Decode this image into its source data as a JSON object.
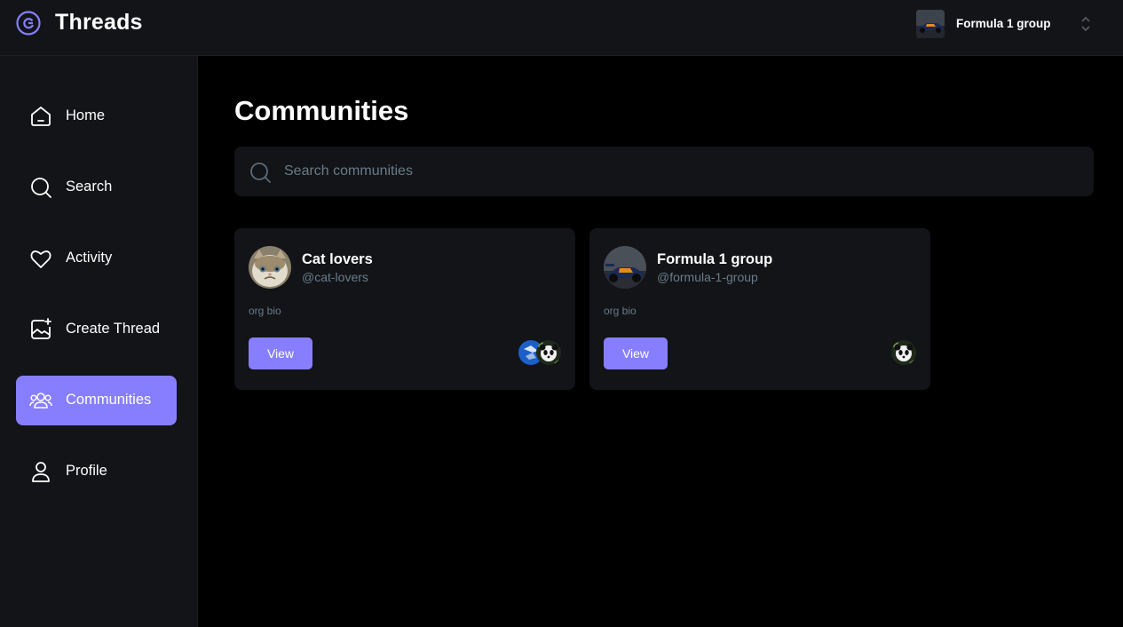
{
  "app": {
    "name": "Threads"
  },
  "org_switcher": {
    "current": "Formula 1 group"
  },
  "sidebar": {
    "items": [
      {
        "label": "Home",
        "icon": "home-icon"
      },
      {
        "label": "Search",
        "icon": "search-icon"
      },
      {
        "label": "Activity",
        "icon": "heart-icon"
      },
      {
        "label": "Create Thread",
        "icon": "create-thread-icon"
      },
      {
        "label": "Communities",
        "icon": "communities-icon",
        "active": true
      },
      {
        "label": "Profile",
        "icon": "profile-icon"
      }
    ]
  },
  "main": {
    "title": "Communities",
    "search": {
      "placeholder": "Search communities",
      "value": ""
    },
    "communities": [
      {
        "name": "Cat lovers",
        "handle": "@cat-lovers",
        "bio": "org bio",
        "button": "View",
        "members": [
          "member-avatar-globe",
          "member-avatar-panda"
        ]
      },
      {
        "name": "Formula 1 group",
        "handle": "@formula-1-group",
        "bio": "org bio",
        "button": "View",
        "members": [
          "member-avatar-panda"
        ]
      }
    ]
  },
  "colors": {
    "accent": "#877eff",
    "panel": "#121417",
    "background": "#000000",
    "muted": "#697c89"
  }
}
